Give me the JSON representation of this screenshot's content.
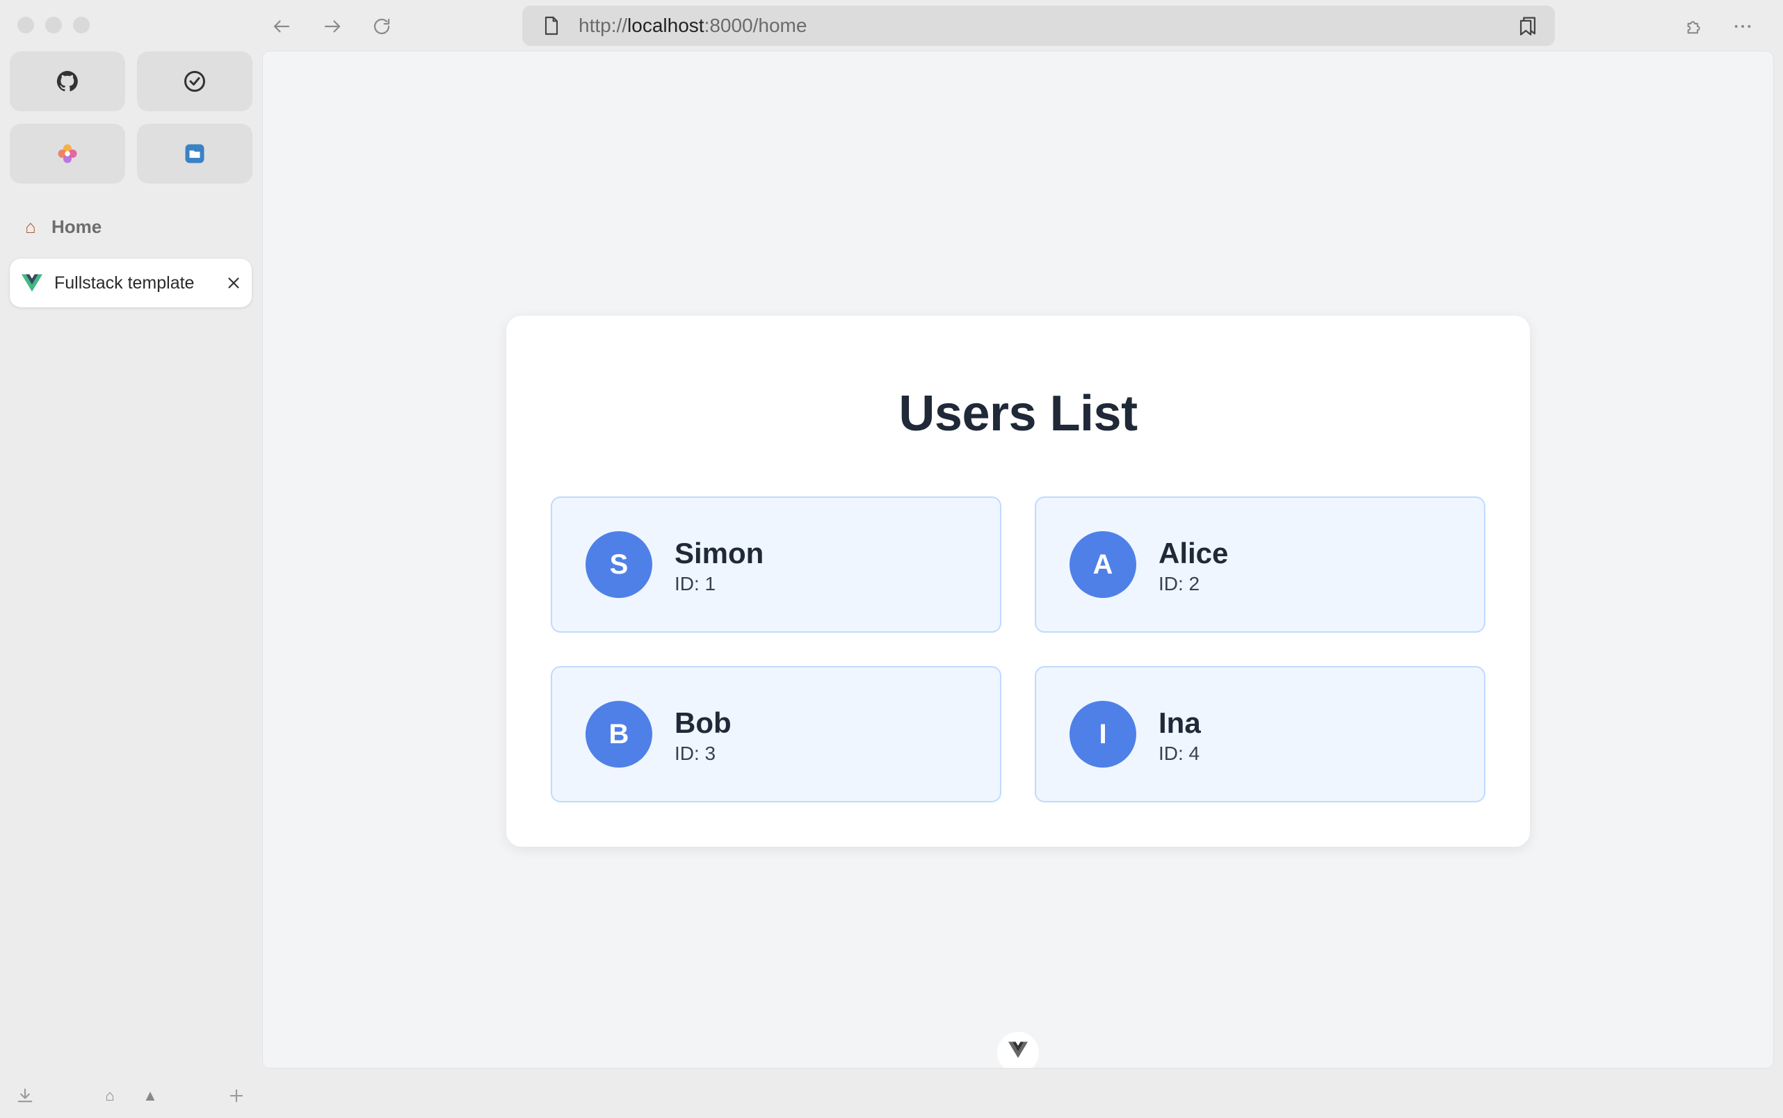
{
  "browser": {
    "url_scheme": "http://",
    "url_host": "localhost",
    "url_rest": ":8000/home"
  },
  "sidebar": {
    "favorites": [
      {
        "icon": "github-icon"
      },
      {
        "icon": "check-circle-icon"
      },
      {
        "icon": "colorful-flower-icon"
      },
      {
        "icon": "folder-app-icon"
      }
    ],
    "home_label": "Home",
    "open_tab_label": "Fullstack template"
  },
  "page": {
    "title": "Users List",
    "users": [
      {
        "initial": "S",
        "name": "Simon",
        "id": "ID: 1"
      },
      {
        "initial": "A",
        "name": "Alice",
        "id": "ID: 2"
      },
      {
        "initial": "B",
        "name": "Bob",
        "id": "ID: 3"
      },
      {
        "initial": "I",
        "name": "Ina",
        "id": "ID: 4"
      }
    ]
  },
  "colors": {
    "avatar": "#4f80e8",
    "card_bg": "#eff6ff",
    "card_border": "#bfdbfe",
    "heading": "#1f2937"
  }
}
